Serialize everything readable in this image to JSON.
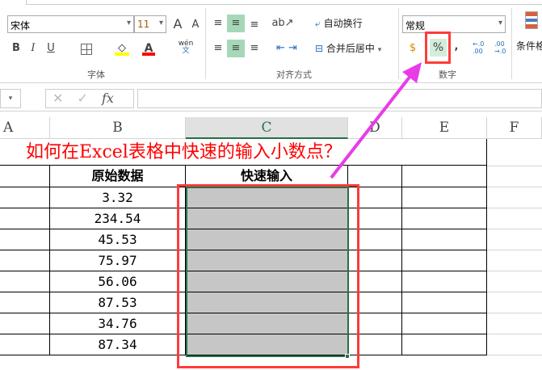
{
  "ribbon": {
    "font_name": "宋体",
    "font_size": "11",
    "grow_font": "A",
    "shrink_font": "A",
    "bold": "B",
    "italic": "I",
    "underline": "U",
    "phonetic_top": "wén",
    "phonetic_bottom": "文",
    "font_group": "字体",
    "wrap_text": "自动换行",
    "merge_center": "合并后居中",
    "alignment_group": "对齐方式",
    "number_format": "常规",
    "percent": "%",
    "comma": ",",
    "inc_decimal": "←.0\n.00",
    "dec_decimal": ".00\n→.0",
    "number_group": "数字",
    "conditional_format": "条件格"
  },
  "formula_bar": {
    "cancel": "✕",
    "enter": "✓",
    "fx": "fx",
    "value": ""
  },
  "columns": [
    "A",
    "B",
    "C",
    "D",
    "E",
    "F"
  ],
  "sheet": {
    "title": "如何在Excel表格中快速的输入小数点？",
    "headers": [
      "原始数据",
      "快速输入"
    ],
    "values": [
      "3.32",
      "234.54",
      "45.53",
      "75.97",
      "56.06",
      "87.53",
      "34.76",
      "87.34"
    ]
  },
  "colors": {
    "selection": "#217346",
    "highlight": "#ff3b3b",
    "arrow": "#e83ce8",
    "title": "#ff0000"
  }
}
